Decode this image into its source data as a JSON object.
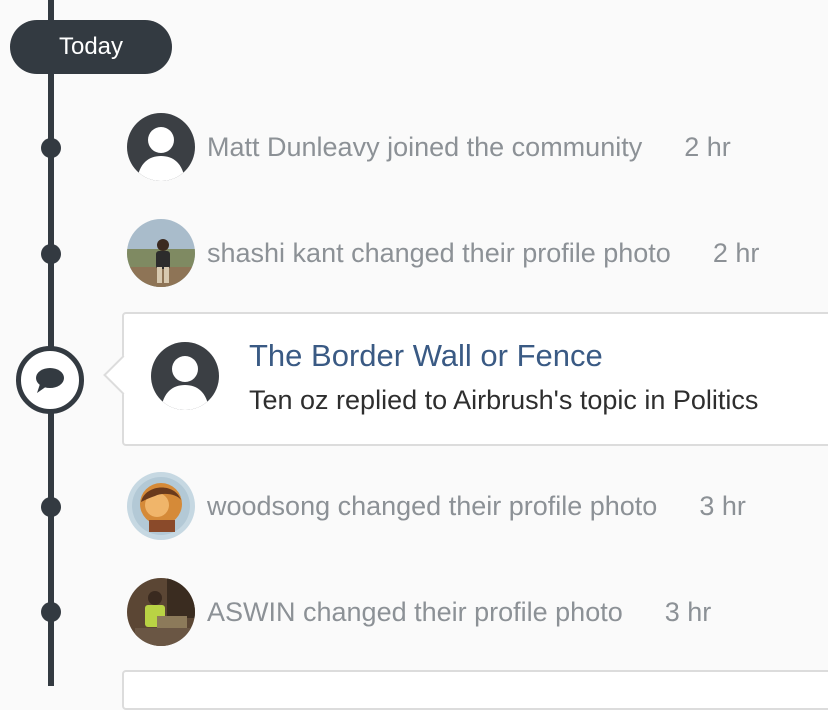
{
  "timeline": {
    "section_label": "Today",
    "line_color": "#333a41",
    "muted_text_color": "#8c9196",
    "link_color": "#3a5a84"
  },
  "activities": [
    {
      "avatar_icon": "default-user-avatar-icon",
      "text": "Matt Dunleavy joined the community",
      "time": "2 hr"
    },
    {
      "avatar_icon": "user-photo-avatar",
      "text": "shashi kant changed their profile photo",
      "time": "2 hr"
    },
    {
      "avatar_icon": "user-photo-avatar",
      "text": "woodsong changed their profile photo",
      "time": "3 hr"
    },
    {
      "avatar_icon": "user-photo-avatar",
      "text": "ASWIN changed their profile photo",
      "time": "3 hr"
    }
  ],
  "featured_post": {
    "node_icon": "chat-bubble-icon",
    "avatar_icon": "default-user-avatar-icon",
    "title": "The Border Wall or Fence",
    "subtitle": "Ten oz replied to Airbrush's topic in Politics"
  }
}
